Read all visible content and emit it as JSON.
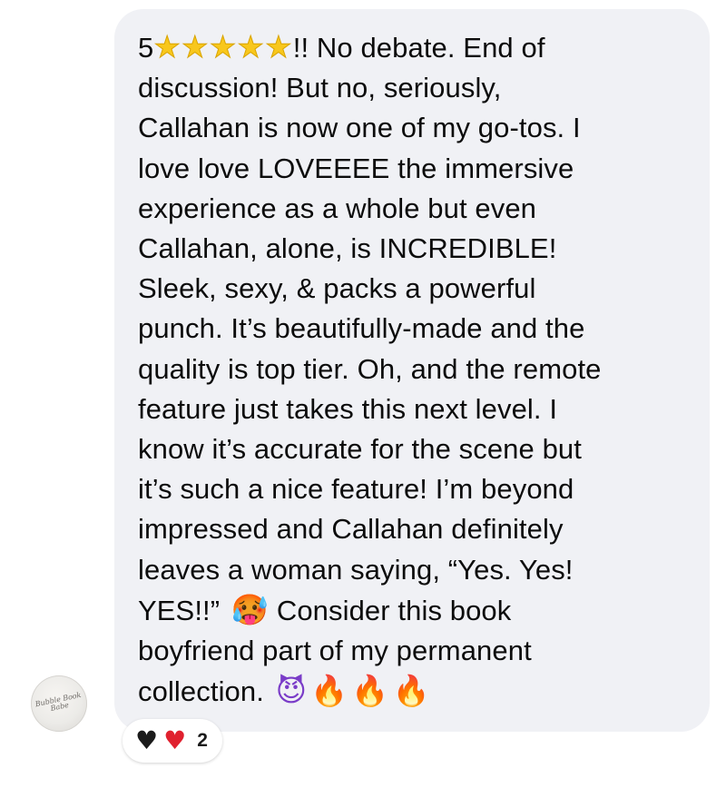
{
  "avatar": {
    "logo_text": "Bubble Book Babe",
    "icon": "profile-avatar-logo"
  },
  "message": {
    "rating": "5",
    "stars": [
      "★",
      "★",
      "★",
      "★",
      "★"
    ],
    "lines": [
      "!! No debate. End of",
      "discussion! But no, seriously,",
      "Callahan is now one of my go-tos. I",
      "love love LOVEEEE the immersive",
      "experience as a whole but even",
      "Callahan, alone, is INCREDIBLE!",
      "Sleek, sexy, & packs a powerful",
      "punch. It’s beautifully-made and the",
      "quality is top tier. Oh, and the remote",
      "feature just takes this next level. I",
      "know it’s accurate for the scene but",
      "it’s such a nice feature!  I’m beyond",
      "impressed and Callahan definitely",
      "leaves a woman saying, “Yes. Yes!",
      "YES!!”",
      "Consider this book",
      "boyfriend part of my permanent",
      "collection."
    ],
    "emoji": {
      "hot_face": "🥵",
      "devil": "😈",
      "fire": "🔥"
    }
  },
  "reactions": {
    "black_heart": "♥",
    "red_heart": "♥",
    "count": "2"
  },
  "colors": {
    "bubble_bg": "#f0f1f5",
    "text": "#0c0c0c",
    "star": "#f8c71c",
    "red_heart": "#e0212f"
  }
}
